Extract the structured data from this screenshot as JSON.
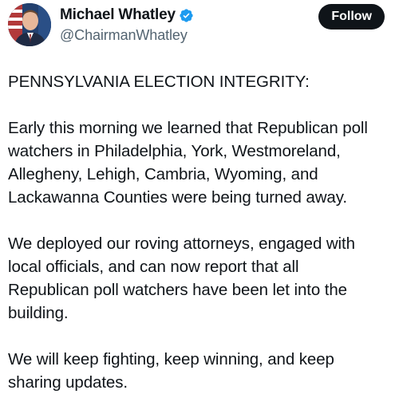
{
  "author": {
    "display_name": "Michael Whatley",
    "handle": "@ChairmanWhatley",
    "verified": true,
    "avatar_icon": "profile-photo"
  },
  "actions": {
    "follow_label": "Follow"
  },
  "post": {
    "paragraphs": [
      "PENNSYLVANIA ELECTION INTEGRITY:",
      "Early this morning we learned that Republican poll\nwatchers in Philadelphia, York, Westmoreland,\nAllegheny, Lehigh, Cambria, Wyoming, and\nLackawanna Counties were being turned away.",
      "We deployed our roving attorneys, engaged with\nlocal officials, and can now report that all\nRepublican poll watchers have been let into the\nbuilding.",
      "We will keep fighting, keep winning, and keep\nsharing updates."
    ]
  },
  "colors": {
    "text_primary": "#0f1419",
    "text_secondary": "#536471",
    "verified_blue": "#1d9bf0",
    "follow_bg": "#0f1419",
    "follow_text": "#ffffff"
  }
}
